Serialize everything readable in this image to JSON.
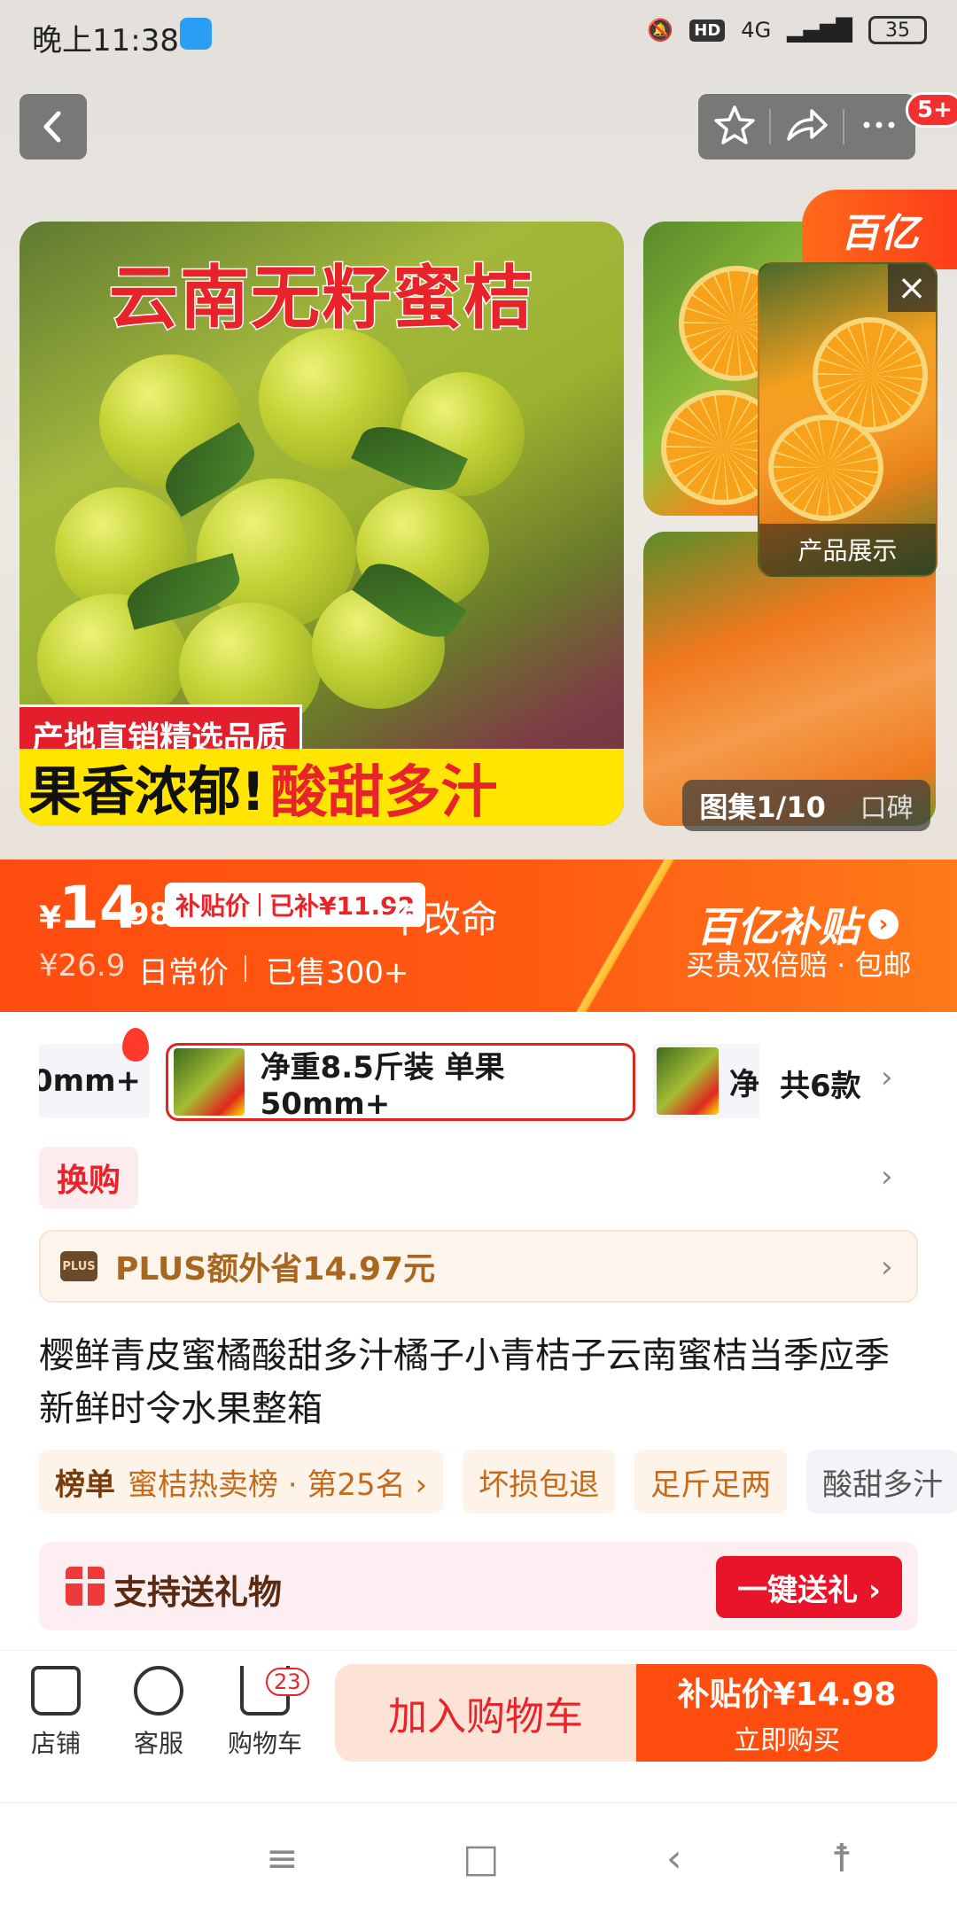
{
  "status_bar": {
    "time": "晚上11:38",
    "network": "4G",
    "hd": "HD",
    "battery": "35"
  },
  "nav": {
    "badge": "5+"
  },
  "hero": {
    "title": "云南无籽蜜桔",
    "tag": "产地直销精选品质",
    "banner_left": "果香浓郁!",
    "banner_right": "酸甜多汁",
    "gallery_label": "图集1/10",
    "reviews_label": "口碑",
    "brand_corner": "百亿",
    "float_video_label": "产品展示"
  },
  "price": {
    "currency": "¥",
    "integer": "14",
    "decimal": ".98",
    "subsidy_label": "补贴价",
    "subsidy_amount": "已补¥11.92",
    "slogan": "不改命",
    "original": "¥26.9",
    "daily_label": "日常价",
    "sold": "已售300+",
    "brand_title": "百亿补贴",
    "brand_sub": "买贵双倍赔 · 包邮"
  },
  "variants": {
    "prev_label": "0mm+",
    "selected_label": "净重8.5斤装 单果50mm+",
    "next_label": "净",
    "count": "共6款"
  },
  "swap": {
    "label": "换购"
  },
  "plus": {
    "icon_text": "PLUS",
    "text": "PLUS额外省14.97元"
  },
  "product": {
    "title": "樱鲜青皮蜜橘酸甜多汁橘子小青桔子云南蜜桔当季应季新鲜时令水果整箱"
  },
  "tags": {
    "rank_label": "榜单",
    "rank_value": "蜜桔热卖榜 · 第25名 ›",
    "tag2": "坏损包退",
    "tag3": "足斤足两",
    "tag4": "酸甜多汁"
  },
  "gift": {
    "text": "支持送礼物",
    "button": "一键送礼 ›"
  },
  "bottom": {
    "store": "店铺",
    "service": "客服",
    "cart": "购物车",
    "cart_count": "23",
    "add_cart": "加入购物车",
    "buy_price": "补贴价¥14.98",
    "buy_now": "立即购买"
  },
  "colors": {
    "accent": "#ff4d0f",
    "brand_red": "#e8232a",
    "plus_brown": "#a8671e"
  }
}
